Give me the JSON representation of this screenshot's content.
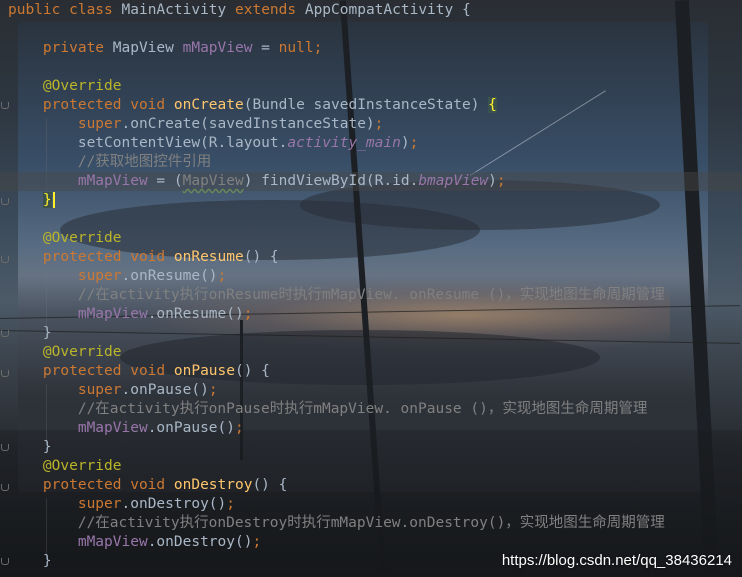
{
  "editor": {
    "lines": [
      [
        {
          "t": "public class ",
          "c": "kw"
        },
        {
          "t": "MainActivity ",
          "c": "plain"
        },
        {
          "t": "extends ",
          "c": "kw"
        },
        {
          "t": "AppCompatActivity {",
          "c": "plain"
        }
      ],
      [],
      [
        {
          "t": "    private ",
          "c": "kw"
        },
        {
          "t": "MapView ",
          "c": "plain"
        },
        {
          "t": "mMapView",
          "c": "fld"
        },
        {
          "t": " = ",
          "c": "plain"
        },
        {
          "t": "null",
          "c": "kw"
        },
        {
          "t": ";",
          "c": "kw"
        }
      ],
      [],
      [
        {
          "t": "    @Override",
          "c": "ann"
        }
      ],
      [
        {
          "t": "    protected void ",
          "c": "kw"
        },
        {
          "t": "onCreate",
          "c": "fn"
        },
        {
          "t": "(Bundle savedInstanceState) ",
          "c": "plain"
        },
        {
          "t": "{",
          "c": "brace-hl"
        }
      ],
      [
        {
          "t": "        super",
          "c": "kw"
        },
        {
          "t": ".onCreate(savedInstanceState)",
          "c": "plain"
        },
        {
          "t": ";",
          "c": "kw"
        }
      ],
      [
        {
          "t": "        setContentView(R.layout.",
          "c": "plain"
        },
        {
          "t": "activity_main",
          "c": "ital"
        },
        {
          "t": ")",
          "c": "plain"
        },
        {
          "t": ";",
          "c": "kw"
        }
      ],
      [
        {
          "t": "        //获取地图控件引用",
          "c": "cmt"
        }
      ],
      [
        {
          "t": "        mMapView",
          "c": "fld"
        },
        {
          "t": " = (",
          "c": "plain"
        },
        {
          "t": "MapView",
          "c": "cast"
        },
        {
          "t": ") findViewById(R.id.",
          "c": "plain"
        },
        {
          "t": "bmapView",
          "c": "ital"
        },
        {
          "t": ")",
          "c": "plain"
        },
        {
          "t": ";",
          "c": "kw"
        }
      ],
      [
        {
          "t": "    ",
          "c": "plain"
        },
        {
          "t": "}",
          "c": "brace-hl"
        },
        {
          "t": "",
          "c": "caret"
        }
      ],
      [],
      [
        {
          "t": "    @Override",
          "c": "ann"
        }
      ],
      [
        {
          "t": "    protected void ",
          "c": "kw"
        },
        {
          "t": "onResume",
          "c": "fn"
        },
        {
          "t": "() {",
          "c": "plain"
        }
      ],
      [
        {
          "t": "        super",
          "c": "kw"
        },
        {
          "t": ".onResume()",
          "c": "plain"
        },
        {
          "t": ";",
          "c": "kw"
        }
      ],
      [
        {
          "t": "        //在activity执行onResume时执行mMapView. onResume ()，实现地图生命周期管理",
          "c": "cmt"
        }
      ],
      [
        {
          "t": "        mMapView",
          "c": "fld"
        },
        {
          "t": ".onResume()",
          "c": "plain"
        },
        {
          "t": ";",
          "c": "kw"
        }
      ],
      [
        {
          "t": "    }",
          "c": "plain"
        }
      ],
      [
        {
          "t": "    @Override",
          "c": "ann"
        }
      ],
      [
        {
          "t": "    protected void ",
          "c": "kw"
        },
        {
          "t": "onPause",
          "c": "fn"
        },
        {
          "t": "() {",
          "c": "plain"
        }
      ],
      [
        {
          "t": "        super",
          "c": "kw"
        },
        {
          "t": ".onPause()",
          "c": "plain"
        },
        {
          "t": ";",
          "c": "kw"
        }
      ],
      [
        {
          "t": "        //在activity执行onPause时执行mMapView. onPause ()，实现地图生命周期管理",
          "c": "cmt"
        }
      ],
      [
        {
          "t": "        mMapView",
          "c": "fld"
        },
        {
          "t": ".onPause()",
          "c": "plain"
        },
        {
          "t": ";",
          "c": "kw"
        }
      ],
      [
        {
          "t": "    }",
          "c": "plain"
        }
      ],
      [
        {
          "t": "    @Override",
          "c": "ann"
        }
      ],
      [
        {
          "t": "    protected void ",
          "c": "kw"
        },
        {
          "t": "onDestroy",
          "c": "fn"
        },
        {
          "t": "() {",
          "c": "plain"
        }
      ],
      [
        {
          "t": "        super",
          "c": "kw"
        },
        {
          "t": ".onDestroy()",
          "c": "plain"
        },
        {
          "t": ";",
          "c": "kw"
        }
      ],
      [
        {
          "t": "        //在activity执行onDestroy时执行mMapView.onDestroy()，实现地图生命周期管理",
          "c": "cmt"
        }
      ],
      [
        {
          "t": "        mMapView",
          "c": "fld"
        },
        {
          "t": ".onDestroy()",
          "c": "plain"
        },
        {
          "t": ";",
          "c": "kw"
        }
      ],
      [
        {
          "t": "    }",
          "c": "plain"
        }
      ]
    ],
    "highlighted_line": 9
  },
  "watermark": "https://blog.csdn.net/qq_38436214",
  "colors": {
    "keyword": "#cc7832",
    "annotation": "#bbb529",
    "method": "#ffc66d",
    "field": "#9876aa",
    "comment": "#808080",
    "text": "#a9b7c6"
  }
}
